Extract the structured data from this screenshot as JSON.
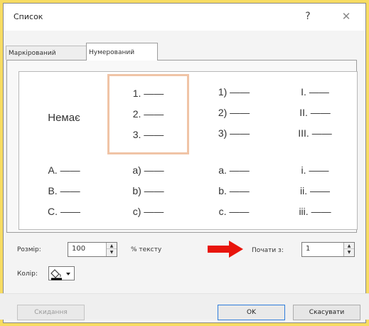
{
  "window": {
    "title": "Список",
    "help_icon": "question-mark-icon",
    "help_glyph": "?",
    "close_icon": "close-icon",
    "close_glyph": "✕"
  },
  "tabs": [
    {
      "label": "Маркірований",
      "selected": false
    },
    {
      "label": "Нумерований",
      "selected": true
    }
  ],
  "gallery": {
    "none_label": "Немає",
    "dash": "——",
    "row1": [
      {
        "lines": [],
        "selected": false
      },
      {
        "lines": [
          "1.",
          "2.",
          "3."
        ],
        "selected": true
      },
      {
        "lines": [
          "1)",
          "2)",
          "3)"
        ],
        "selected": false
      },
      {
        "lines": [
          "I.",
          "II.",
          "III."
        ],
        "selected": false
      }
    ],
    "row2": [
      {
        "lines": [
          "A.",
          "B.",
          "C."
        ],
        "selected": false
      },
      {
        "lines": [
          "a)",
          "b)",
          "c)"
        ],
        "selected": false
      },
      {
        "lines": [
          "a.",
          "b.",
          "c."
        ],
        "selected": false
      },
      {
        "lines": [
          "i.",
          "ii.",
          "iii."
        ],
        "selected": false
      }
    ]
  },
  "size": {
    "label": "Розмір:",
    "value": "100",
    "suffix": "% тексту"
  },
  "start": {
    "label": "Почати з:",
    "value": "1"
  },
  "color": {
    "label": "Колір:",
    "swatch": "#000000",
    "icon": "paint-bucket-icon"
  },
  "annotation": {
    "arrow_color": "#e8150c"
  },
  "buttons": {
    "reset": "Скидання",
    "ok": "OK",
    "cancel": "Скасувати"
  },
  "colors": {
    "background": "#f7dc62",
    "selection_border": "#f0c4a6",
    "ok_border": "#2f7ddb"
  }
}
